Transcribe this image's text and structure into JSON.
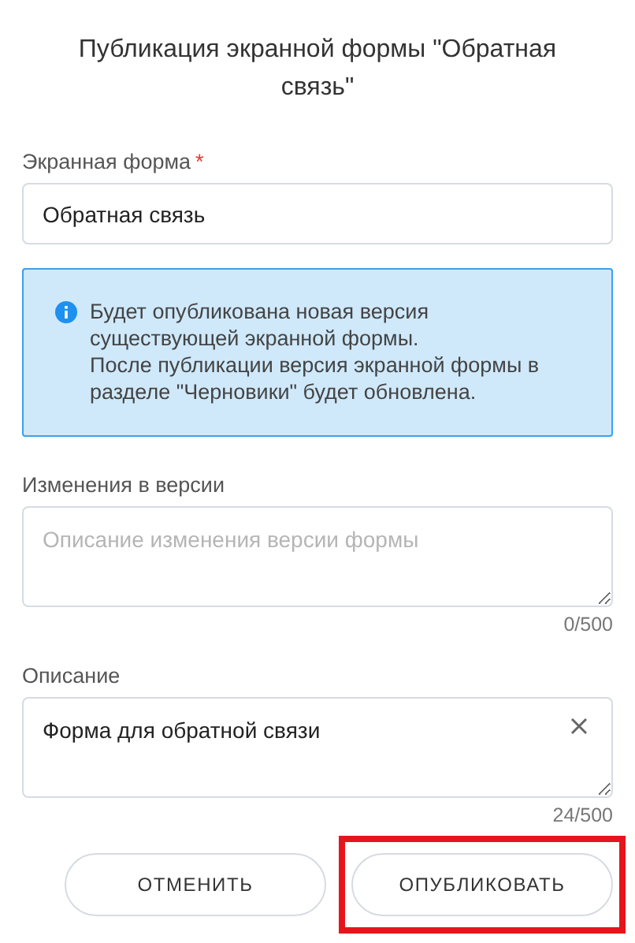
{
  "title": "Публикация экранной формы \"Обратная связь\"",
  "fields": [
    {
      "kind": "input",
      "label": "Экранная форма",
      "required_mark": "*",
      "value": "Обратная связь"
    },
    {
      "kind": "info",
      "paragraphs": [
        "Будет опубликована новая версия существующей экранной формы.",
        "После публикации версия экранной формы в разделе \"Черновики\" будет обновлена."
      ]
    },
    {
      "kind": "textarea",
      "label": "Изменения в версии",
      "placeholder": "Описание изменения версии формы",
      "counter": "0/500"
    },
    {
      "kind": "textarea",
      "label": "Описание",
      "value": "Форма для обратной связи",
      "counter": "24/500",
      "clearable": true
    }
  ],
  "buttons": [
    {
      "label": "ОТМЕНИТЬ"
    },
    {
      "label": "ОПУБЛИКОВАТЬ",
      "highlighted": true
    }
  ]
}
